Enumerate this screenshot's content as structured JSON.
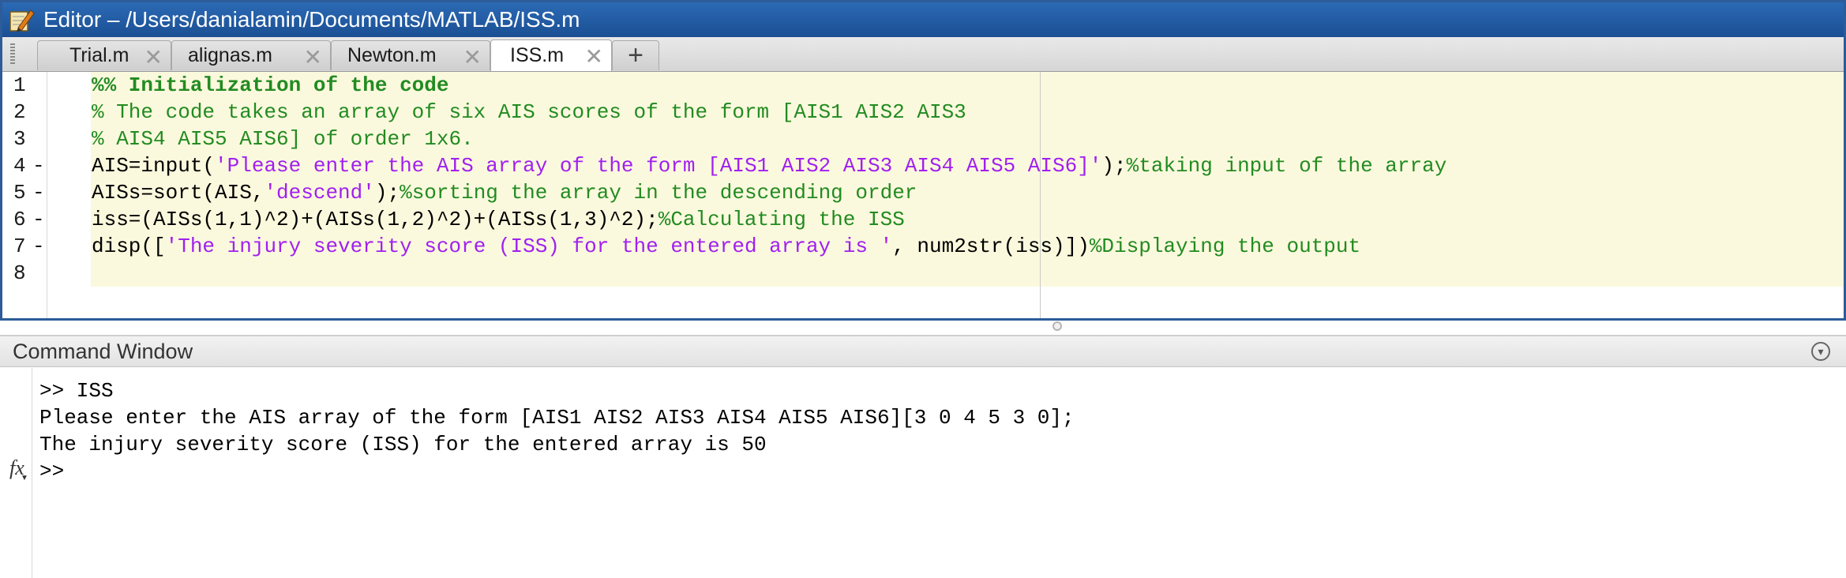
{
  "editor": {
    "title": "Editor – /Users/danialamin/Documents/MATLAB/ISS.m",
    "tabs": [
      {
        "label": "Trial.m",
        "active": false
      },
      {
        "label": "alignas.m",
        "active": false
      },
      {
        "label": "Newton.m",
        "active": false
      },
      {
        "label": "ISS.m",
        "active": true
      }
    ],
    "close_glyph": "✕",
    "add_tab_label": "+",
    "lines": [
      {
        "num": "1",
        "dash": "",
        "segments": [
          {
            "type": "cell",
            "text": "%% Initialization of the code"
          }
        ]
      },
      {
        "num": "2",
        "dash": "",
        "segments": [
          {
            "type": "comment",
            "text": "% The code takes an array of six AIS scores of the form [AIS1 AIS2 AIS3"
          }
        ]
      },
      {
        "num": "3",
        "dash": "",
        "segments": [
          {
            "type": "comment",
            "text": "% AIS4 AIS5 AIS6] of order 1x6."
          }
        ]
      },
      {
        "num": "4",
        "dash": "-",
        "segments": [
          {
            "type": "code",
            "text": "AIS=input("
          },
          {
            "type": "str",
            "text": "'Please enter the AIS array of the form [AIS1 AIS2 AIS3 AIS4 AIS5 AIS6]'"
          },
          {
            "type": "code",
            "text": ");"
          },
          {
            "type": "comment",
            "text": "%taking input of the array"
          }
        ]
      },
      {
        "num": "5",
        "dash": "-",
        "segments": [
          {
            "type": "code",
            "text": "AISs=sort(AIS,"
          },
          {
            "type": "str",
            "text": "'descend'"
          },
          {
            "type": "code",
            "text": ");"
          },
          {
            "type": "comment",
            "text": "%sorting the array in the descending order"
          }
        ]
      },
      {
        "num": "6",
        "dash": "-",
        "segments": [
          {
            "type": "code",
            "text": "iss=(AISs(1,1)^2)+(AISs(1,2)^2)+(AISs(1,3)^2);"
          },
          {
            "type": "comment",
            "text": "%Calculating the ISS"
          }
        ]
      },
      {
        "num": "7",
        "dash": "-",
        "segments": [
          {
            "type": "code",
            "text": "disp(["
          },
          {
            "type": "str",
            "text": "'The injury severity score (ISS) for the entered array is '"
          },
          {
            "type": "code",
            "text": ", num2str(iss)])"
          },
          {
            "type": "comment",
            "text": "%Displaying the output"
          }
        ]
      },
      {
        "num": "8",
        "dash": "",
        "segments": []
      }
    ]
  },
  "command_window": {
    "title": "Command Window",
    "lines": [
      ">> ISS",
      "Please enter the AIS array of the form [AIS1 AIS2 AIS3 AIS4 AIS5 AIS6][3 0 4 5 3 0];",
      "The injury severity score (ISS) for the entered array is 50",
      ">> "
    ],
    "fx_label": "fx"
  },
  "colors": {
    "title_bar": "#1b4f93",
    "code_background": "#fbf9dd",
    "comment": "#228b22",
    "string": "#a020f0"
  }
}
